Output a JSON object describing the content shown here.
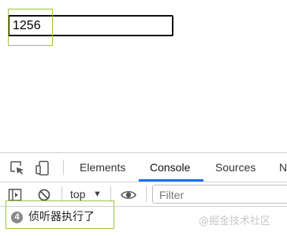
{
  "page": {
    "input_value": "1256"
  },
  "devtools": {
    "tabs": [
      {
        "label": "Elements"
      },
      {
        "label": "Console"
      },
      {
        "label": "Sources"
      },
      {
        "label": "N"
      }
    ],
    "active_tab": "Console",
    "toolbar": {
      "context": "top",
      "filter_placeholder": "Filter"
    },
    "console": {
      "messages": [
        {
          "count": "4",
          "text": "侦听器执行了"
        }
      ]
    },
    "accent_color": "#1a73e8"
  },
  "watermark": "@掘金技术社区"
}
